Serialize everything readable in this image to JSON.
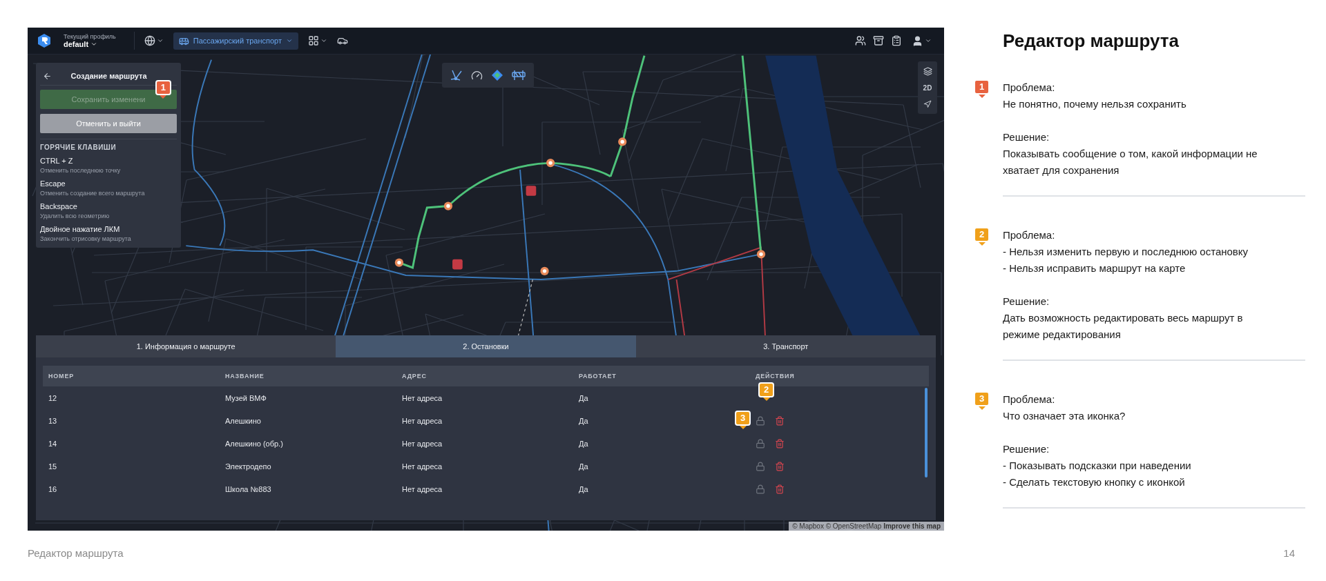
{
  "topbar": {
    "profile_label": "Текущий профиль",
    "profile_name": "default",
    "transport_mode": "Пассажирский транспорт"
  },
  "route_panel": {
    "title": "Создание маршрута",
    "save_button": {
      "label": "Сохранить изменени",
      "disabled": true
    },
    "cancel_button": "Отменить и выйти",
    "hotkeys_title": "ГОРЯЧИЕ КЛАВИШИ",
    "hotkeys": [
      {
        "key": "CTRL + Z",
        "description": "Отменить последнюю точку"
      },
      {
        "key": "Escape",
        "description": "Отменить создание всего маршрута"
      },
      {
        "key": "Backspace",
        "description": "Удалить всю геометрию"
      },
      {
        "key": "Двойное нажатие ЛКМ",
        "description": "Закончить отрисовку маршрута"
      }
    ]
  },
  "map_controls": {
    "view_mode": "2D"
  },
  "tabs": [
    {
      "label": "1. Информация о маршруте",
      "selected": false
    },
    {
      "label": "2. Остановки",
      "selected": true
    },
    {
      "label": "3. Транспорт",
      "selected": false
    }
  ],
  "table": {
    "columns": [
      "НОМЕР",
      "НАЗВАНИЕ",
      "АДРЕС",
      "РАБОТАЕТ",
      "ДЕЙСТВИЯ"
    ],
    "rows": [
      {
        "cells": [
          "12",
          "Музей ВМФ",
          "Нет адреса",
          "Да"
        ],
        "actions_visible": false
      },
      {
        "cells": [
          "13",
          "Алешкино",
          "Нет адреса",
          "Да"
        ],
        "actions_visible": true
      },
      {
        "cells": [
          "14",
          "Алешкино (обр.)",
          "Нет адреса",
          "Да"
        ],
        "actions_visible": true
      },
      {
        "cells": [
          "15",
          "Электродепо",
          "Нет адреса",
          "Да"
        ],
        "actions_visible": true
      },
      {
        "cells": [
          "16",
          "Школа №883",
          "Нет адреса",
          "Да"
        ],
        "actions_visible": true
      }
    ]
  },
  "attribution": "© Mapbox © OpenStreetMap **Improve this map**",
  "markers": [
    {
      "kind": "save_button",
      "number": "1",
      "color": "#e8623f"
    },
    {
      "kind": "table_header",
      "number": "2",
      "color": "#f0a01a"
    },
    {
      "kind": "row_action",
      "number": "3",
      "color": "#f0a01a"
    }
  ],
  "notes": {
    "title": "Редактор маршрута",
    "items": [
      {
        "number": "1",
        "color": "#e8623f",
        "problem_label": "Проблема:",
        "problem_lines": [
          "Не понятно, почему нельзя сохранить"
        ],
        "solution_label": "Решение:",
        "solution_lines": [
          "Показывать сообщение о том, какой информации не хватает для сохранения"
        ]
      },
      {
        "number": "2",
        "color": "#f0a01a",
        "problem_label": "Проблема:",
        "problem_lines": [
          "- Нельзя изменить первую и последнюю остановку",
          "- Нельзя исправить маршрут на карте"
        ],
        "solution_label": "Решение:",
        "solution_lines": [
          "Дать возможность редактировать весь маршрут в режиме редактирования"
        ]
      },
      {
        "number": "3",
        "color": "#f0a01a",
        "problem_label": "Проблема:",
        "problem_lines": [
          "Что означает эта иконка?"
        ],
        "solution_label": "Решение:",
        "solution_lines": [
          "- Показывать подсказки при наведении",
          "- Сделать текстовую кнопку с иконкой"
        ]
      }
    ]
  },
  "footer": {
    "title": "Редактор маршрута",
    "page": "14"
  }
}
